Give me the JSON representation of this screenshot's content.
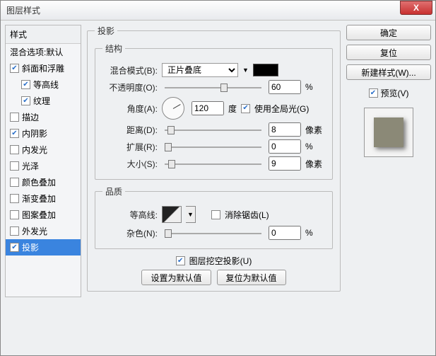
{
  "window": {
    "title": "图层样式",
    "close": "X"
  },
  "styles": {
    "header": "样式",
    "blend_defaults": "混合选项:默认",
    "bevel": "斜面和浮雕",
    "contour": "等高线",
    "texture": "纹理",
    "stroke": "描边",
    "inner_shadow": "内阴影",
    "inner_glow": "内发光",
    "satin": "光泽",
    "color_overlay": "颜色叠加",
    "gradient_overlay": "渐变叠加",
    "pattern_overlay": "图案叠加",
    "outer_glow": "外发光",
    "drop_shadow": "投影"
  },
  "panel": {
    "title": "投影",
    "structure": "结构",
    "quality": "品质",
    "blend_mode_label": "混合模式(B):",
    "blend_mode_value": "正片叠底",
    "opacity_label": "不透明度(O):",
    "opacity_value": "60",
    "percent": "%",
    "angle_label": "角度(A):",
    "angle_value": "120",
    "angle_unit": "度",
    "global_light": "使用全局光(G)",
    "distance_label": "距离(D):",
    "distance_value": "8",
    "px": "像素",
    "spread_label": "扩展(R):",
    "spread_value": "0",
    "size_label": "大小(S):",
    "size_value": "9",
    "contour_label": "等高线:",
    "antialias": "消除锯齿(L)",
    "noise_label": "杂色(N):",
    "noise_value": "0",
    "knockout": "图层挖空投影(U)",
    "make_default": "设置为默认值",
    "reset_default": "复位为默认值"
  },
  "buttons": {
    "ok": "确定",
    "cancel": "复位",
    "new_style": "新建样式(W)...",
    "preview": "预览(V)"
  }
}
